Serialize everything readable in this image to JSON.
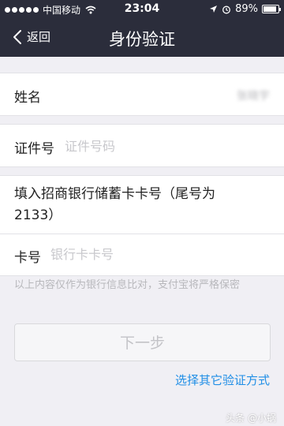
{
  "status_bar": {
    "carrier": "中国移动",
    "time": "23:04",
    "battery": "89%",
    "battery_level": 0.89,
    "icons": [
      "signal-dots-icon",
      "wifi-icon",
      "location-arrow-icon",
      "alarm-icon",
      "battery-icon"
    ]
  },
  "nav": {
    "back_label": "返回",
    "title": "身份验证"
  },
  "form": {
    "name_label": "姓名",
    "name_value": "张晓宇",
    "id_label": "证件号",
    "id_placeholder": "证件号码",
    "card_prompt": "填入招商银行储蓄卡卡号（尾号为2133）",
    "card_label": "卡号",
    "card_placeholder": "银行卡卡号"
  },
  "hint": "以上内容仅作为银行信息比对，支付宝将严格保密",
  "next_button": "下一步",
  "alt_link": "选择其它验证方式",
  "watermark": "头条 @小蜗"
}
